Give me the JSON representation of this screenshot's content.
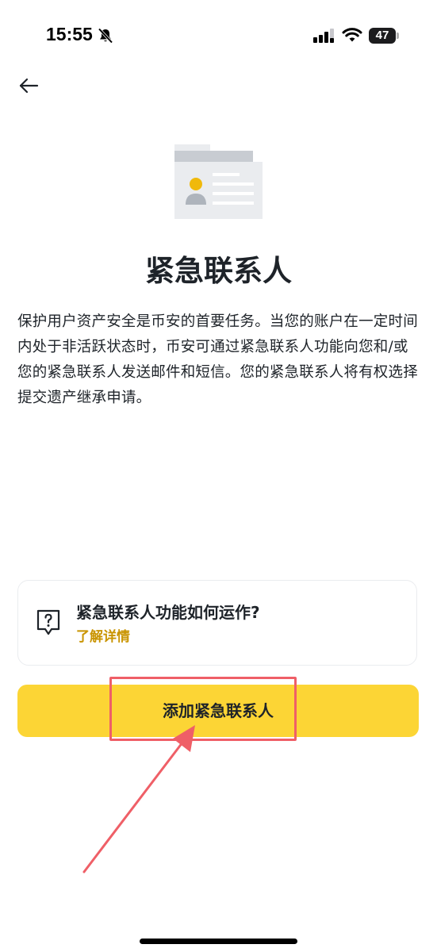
{
  "status_bar": {
    "time": "15:55",
    "battery": "47",
    "icons": [
      "bell-muted-icon",
      "signal-icon",
      "wifi-icon",
      "battery-icon"
    ]
  },
  "header": {
    "back_icon": "arrow-left-icon"
  },
  "main": {
    "illustration_icon": "contact-card-icon",
    "title": "紧急联系人",
    "description": "保护用户资产安全是币安的首要任务。当您的账户在一定时间内处于非活跃状态时，币安可通过紧急联系人功能向您和/或您的紧急联系人发送邮件和短信。您的紧急联系人将有权选择提交遗产继承申请。"
  },
  "info_card": {
    "icon": "question-bubble-icon",
    "title": "紧急联系人功能如何运作?",
    "link": "了解详情"
  },
  "actions": {
    "add_button": "添加紧急联系人"
  },
  "colors": {
    "brand_yellow": "#FCD535",
    "link_gold": "#C99400",
    "annotation_red": "#EF5F67",
    "text_primary": "#1E2329"
  }
}
